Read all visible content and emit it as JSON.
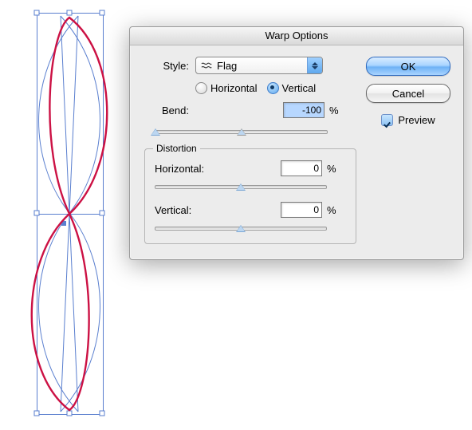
{
  "dialog": {
    "title": "Warp Options",
    "style_label": "Style:",
    "style_value": "Flag",
    "orientation": {
      "horizontal_label": "Horizontal",
      "vertical_label": "Vertical",
      "selected": "Vertical"
    },
    "bend": {
      "label": "Bend:",
      "value": "-100",
      "unit": "%"
    },
    "distortion": {
      "group_label": "Distortion",
      "horizontal": {
        "label": "Horizontal:",
        "value": "0",
        "unit": "%"
      },
      "vertical": {
        "label": "Vertical:",
        "value": "0",
        "unit": "%"
      }
    },
    "buttons": {
      "ok": "OK",
      "cancel": "Cancel"
    },
    "preview": {
      "label": "Preview",
      "checked": true
    }
  }
}
